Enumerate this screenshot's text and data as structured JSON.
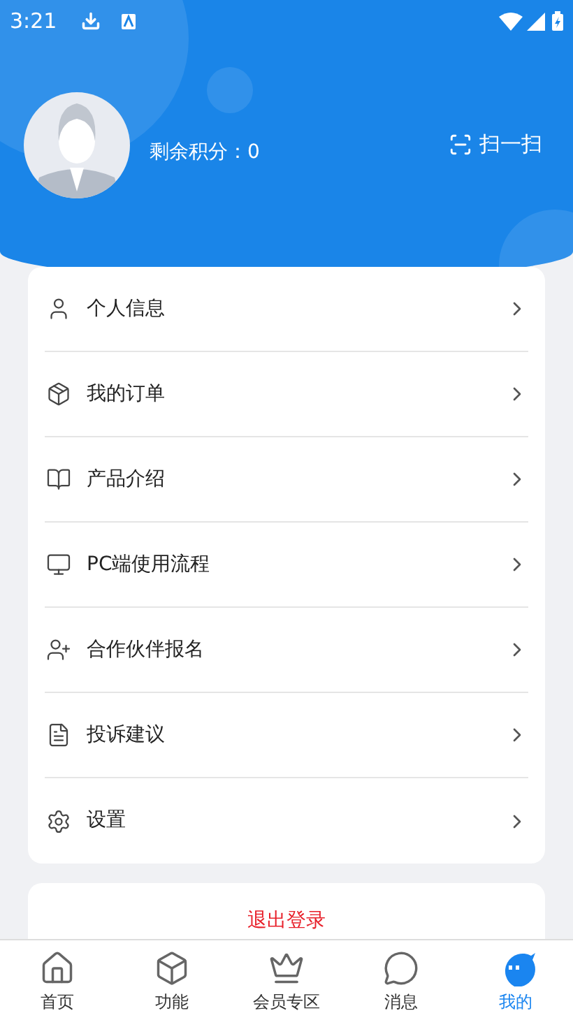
{
  "status_bar": {
    "time": "3:21"
  },
  "profile": {
    "points_label": "剩余积分：0",
    "scan_label": "扫一扫"
  },
  "menu": [
    {
      "label": "个人信息"
    },
    {
      "label": "我的订单"
    },
    {
      "label": "产品介绍"
    },
    {
      "label": "PC端使用流程"
    },
    {
      "label": "合作伙伴报名"
    },
    {
      "label": "投诉建议"
    },
    {
      "label": "设置"
    }
  ],
  "logout": {
    "label": "退出登录"
  },
  "tab_bar": [
    {
      "label": "首页",
      "selected": false
    },
    {
      "label": "功能",
      "selected": false
    },
    {
      "label": "会员专区",
      "selected": false
    },
    {
      "label": "消息",
      "selected": false
    },
    {
      "label": "我的",
      "selected": true
    }
  ]
}
